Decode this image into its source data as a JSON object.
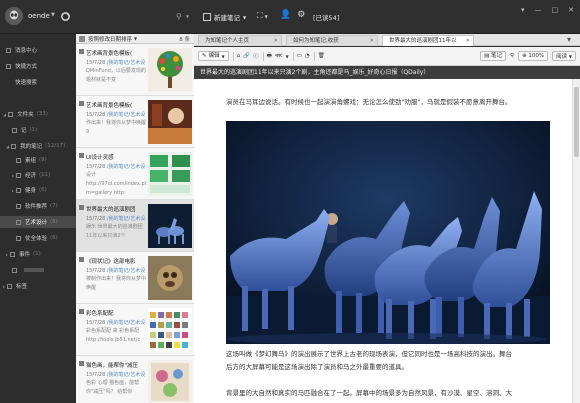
{
  "topbar": {
    "user": "oende",
    "new_note": "新建笔记",
    "sign_in": "[已读54]"
  },
  "sidebar": {
    "items": [
      {
        "label": "消息中心",
        "count": ""
      },
      {
        "label": "快捷方式",
        "count": ""
      },
      {
        "label": "快速搜索",
        "count": ""
      },
      {
        "label": "文件夹",
        "count": "(33)"
      },
      {
        "label": "记",
        "count": "(1)"
      },
      {
        "label": "我的笔记",
        "count": "(12/17)"
      },
      {
        "label": "素组",
        "count": "(9)"
      },
      {
        "label": "经济",
        "count": "(11)"
      },
      {
        "label": "健身",
        "count": "(6)"
      },
      {
        "label": "软件推荐",
        "count": "(7)"
      },
      {
        "label": "艺术设计",
        "count": "(8)"
      },
      {
        "label": "仗全体验",
        "count": "(6)"
      },
      {
        "label": "事件",
        "count": "(1)"
      },
      {
        "label": "",
        "count": ""
      },
      {
        "label": "标签",
        "count": ""
      }
    ]
  },
  "list": {
    "sort_label": "按照修改日期排序",
    "count": "8 条",
    "notes": [
      {
        "title": "艺术画背景色模板(",
        "date": "15/7/28",
        "source": "/我的笔记/艺术设",
        "snippet": "QMinFund，以后要发现的题材就是不变"
      },
      {
        "title": "艺术画背景色模板(",
        "date": "15/7/28",
        "source": "/我的笔记/艺术设",
        "snippet": "作出来！我将你从梦中唤醒 9"
      },
      {
        "title": "UI设计灵感",
        "date": "15/7/28",
        "source": "/我的笔记/艺术设",
        "snippet": "设计 http://97ui.com/index.php?m=gallery http:"
      },
      {
        "title": "世界最大的巡演剧团",
        "date": "15/7/28",
        "source": "/我的笔记/艺术设",
        "snippet": "娱乐 世界最大的巡演剧团11年以来只演2个"
      },
      {
        "title": "《现状记》这部电影",
        "date": "15/7/28",
        "source": "/我的笔记/艺术设",
        "snippet": "被制作出来！我将你从梦中唤醒"
      },
      {
        "title": "彩色系配配",
        "date": "15/7/28",
        "source": "/我的笔记/艺术设",
        "snippet": "彩色系配配 来 彩色系配 http://tools.jb51.net/c"
      },
      {
        "title": "猫色画，能帮你\"减压",
        "date": "15/7/28",
        "source": "/我的笔记/艺术设",
        "snippet": "色彩 心理 猫色画，能帮你\"减压\"吗？ 给帮你"
      }
    ]
  },
  "tabs": [
    {
      "label": "为知笔记个人主页"
    },
    {
      "label": "如何为知笔记,收获"
    },
    {
      "label": "世界最大的巡演剧团11年以"
    }
  ],
  "toolbar": {
    "edit": "编辑",
    "notes": "笔记",
    "zoom": "100%",
    "read": "阅读"
  },
  "note": {
    "title": "世界最大的巡演剧团11年以来只演2个剧，主角还都是马_娱乐_好奇心日报（QDaily）",
    "para1": "演员在马耳边说话。有时候也一起演演角螺戏：无论怎么使劲\"劝服\"，马就是假装不愿意离开舞台。",
    "para2a": "这场叫做《梦幻舞马》的演出展示了世界上古老的现场表演，但它同时也是一场高科技的演出。舞台",
    "para2b": "后方的大屏幕可能是这场演出除了演员和马之外最重要的道具。",
    "para3": "背景里的大自然和真实的马匹融合在了一起。屏幕中的场景多为自然风景，有沙漠、星空、溶洞、大"
  }
}
